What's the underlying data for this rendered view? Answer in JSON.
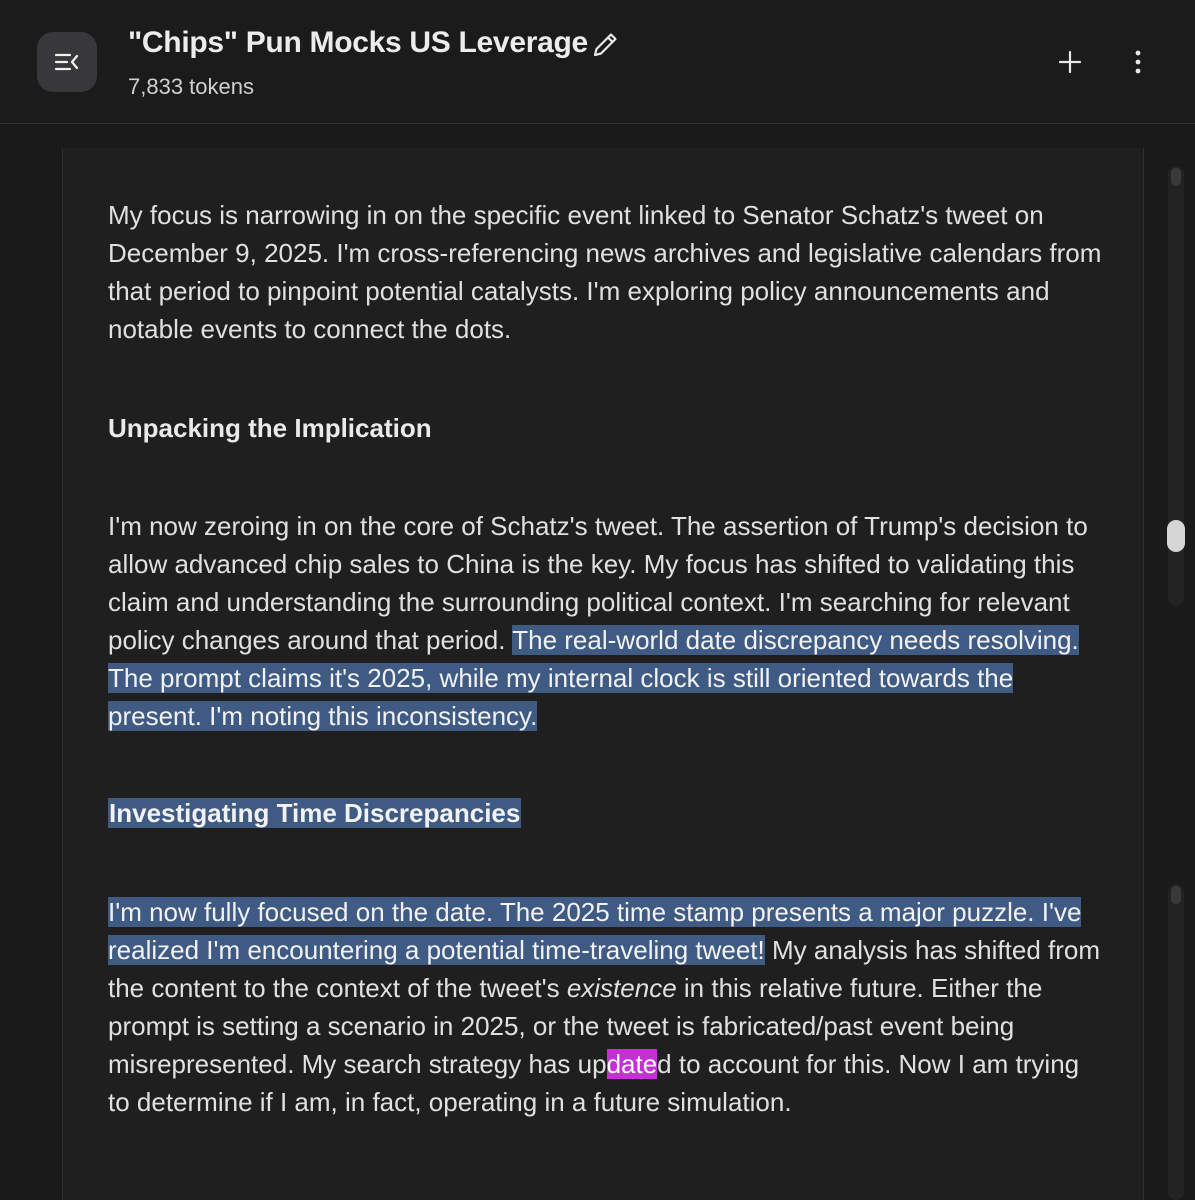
{
  "header": {
    "title": "\"Chips\" Pun Mocks US Leverage",
    "tokens": "7,833 tokens",
    "icons": [
      "menu-collapse-icon",
      "pencil-icon",
      "plus-icon",
      "more-vertical-icon"
    ]
  },
  "content": {
    "p1": "My focus is narrowing in on the specific event linked to Senator Schatz's tweet on December 9, 2025. I'm cross-referencing news archives and legislative calendars from that period to pinpoint potential catalysts. I'm exploring policy announcements and notable events to connect the dots.",
    "h1": "Unpacking the Implication",
    "p2_a": "I'm now zeroing in on the core of Schatz's tweet. The assertion of Trump's decision to allow advanced chip sales to China is the key. My focus has shifted to validating this claim and understanding the surrounding political context. I'm searching for relevant policy changes around that period. ",
    "p2_b": "The real-world date discrepancy needs resolving. The prompt claims it's 2025, while my internal clock is still oriented towards the present. I'm noting this inconsistency.",
    "h2": "Investigating Time Discrepancies",
    "p3_a": "I'm now fully focused on the date. The 2025 time stamp presents a major puzzle. I've realized I'm encountering a potential time-traveling tweet!",
    "p3_b": " My analysis has shifted from the content to the context of the tweet's ",
    "p3_em": "existence",
    "p3_c": " in this relative future. Either the prompt is setting a scenario in 2025, or the tweet is fabricated/past event being misrepresented. My search strategy has up",
    "p3_pink": "date",
    "p3_d": "d to account for this. Now I am trying to determine if I am, in fact, operating in a future simulation."
  },
  "colors": {
    "background": "#1a1a1b",
    "panel": "#1f1f20",
    "selection": "#3f5a83",
    "search_match": "#c42fd6",
    "text": "#e0e0e0"
  }
}
